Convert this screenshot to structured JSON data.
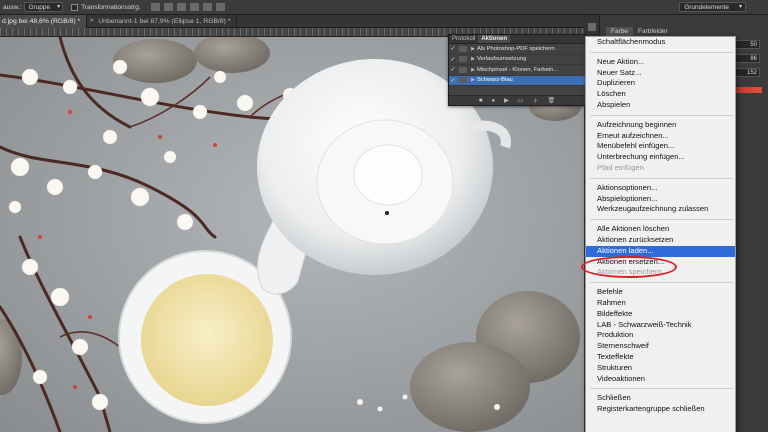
{
  "options_bar": {
    "auto_select_label": "ausw.:",
    "auto_select_value": "Gruppe",
    "transform_label": "Transformationsstrg.",
    "workspace": "Grundelemente"
  },
  "tabs": [
    {
      "label": "d.jpg bei 48,6% (RGB/8) *",
      "active": true
    },
    {
      "label": "Unbenannt-1 bei 87,9% (Ellipse 1, RGB/8) *",
      "active": false
    }
  ],
  "actions_panel": {
    "tabs": [
      "Protokoll",
      "Aktionen"
    ],
    "rows": [
      {
        "label": "Als Photoshop-PDF speichern",
        "checked": true,
        "selected": false
      },
      {
        "label": "Verlaufsumsetzung",
        "checked": true,
        "selected": false
      },
      {
        "label": "Mischpinsel - Klonen, Farbein...",
        "checked": true,
        "selected": false
      },
      {
        "label": "Schwarz-Blau",
        "checked": true,
        "selected": true
      }
    ]
  },
  "color_panel": {
    "tabs": [
      "Farbe",
      "Farbfelder"
    ],
    "values": [
      "50",
      "86",
      "152"
    ]
  },
  "menu": {
    "groups": [
      [
        {
          "label": "Schaltflächenmodus"
        }
      ],
      [
        {
          "label": "Neue Aktion..."
        },
        {
          "label": "Neuer Satz..."
        },
        {
          "label": "Duplizieren"
        },
        {
          "label": "Löschen"
        },
        {
          "label": "Abspielen"
        }
      ],
      [
        {
          "label": "Aufzeichnung beginnen"
        },
        {
          "label": "Erneut aufzeichnen..."
        },
        {
          "label": "Menübefehl einfügen..."
        },
        {
          "label": "Unterbrechung einfügen..."
        },
        {
          "label": "Pfad einfügen",
          "disabled": true
        }
      ],
      [
        {
          "label": "Aktionsoptionen..."
        },
        {
          "label": "Abspieloptionen..."
        },
        {
          "label": "Werkzeugaufzeichnung zulassen"
        }
      ],
      [
        {
          "label": "Alle Aktionen löschen"
        },
        {
          "label": "Aktionen zurücksetzen"
        },
        {
          "label": "Aktionen laden...",
          "highlighted": true
        },
        {
          "label": "Aktionen ersetzen..."
        },
        {
          "label": "Aktionen speichern...",
          "disabled": true
        }
      ],
      [
        {
          "label": "Befehle"
        },
        {
          "label": "Rahmen"
        },
        {
          "label": "Bildeffekte"
        },
        {
          "label": "LAB - Schwarzweiß-Technik"
        },
        {
          "label": "Produktion"
        },
        {
          "label": "Sternenschweif"
        },
        {
          "label": "Texteffekte"
        },
        {
          "label": "Strukturen"
        },
        {
          "label": "Videoaktionen"
        }
      ],
      [
        {
          "label": "Schließen"
        },
        {
          "label": "Registerkartengruppe schließen"
        }
      ]
    ]
  }
}
